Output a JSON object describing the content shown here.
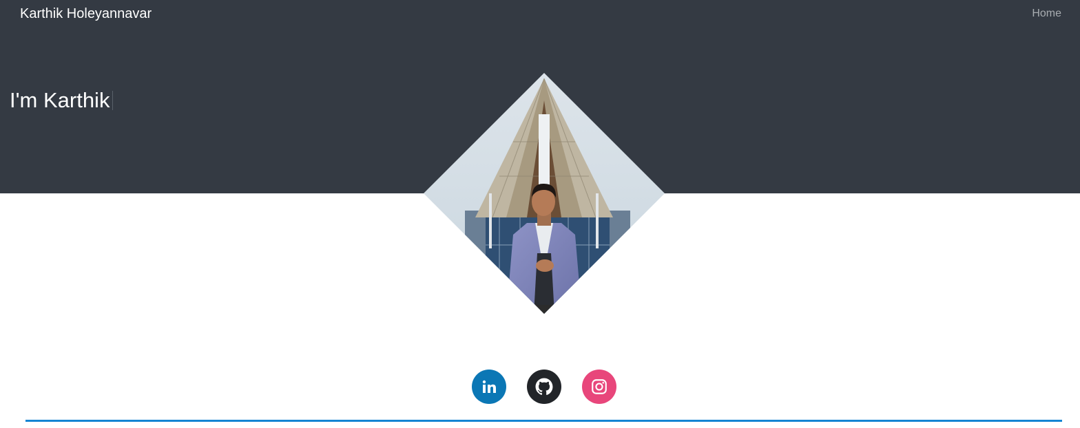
{
  "navbar": {
    "brand": "Karthik Holeyannavar",
    "home_label": "Home"
  },
  "hero": {
    "headline": "I'm Karthik"
  },
  "photo": {
    "alt": "Portrait of Karthik in a blue blazer in front of a modern building"
  },
  "social": [
    {
      "name": "LinkedIn",
      "icon": "linkedin-icon",
      "color": "#0b77b5"
    },
    {
      "name": "GitHub",
      "icon": "github-icon",
      "color": "#222529"
    },
    {
      "name": "Instagram",
      "icon": "instagram-icon",
      "color": "#e8467b"
    }
  ],
  "colors": {
    "header_bg": "#343a43",
    "accent_line": "#1485d3"
  }
}
